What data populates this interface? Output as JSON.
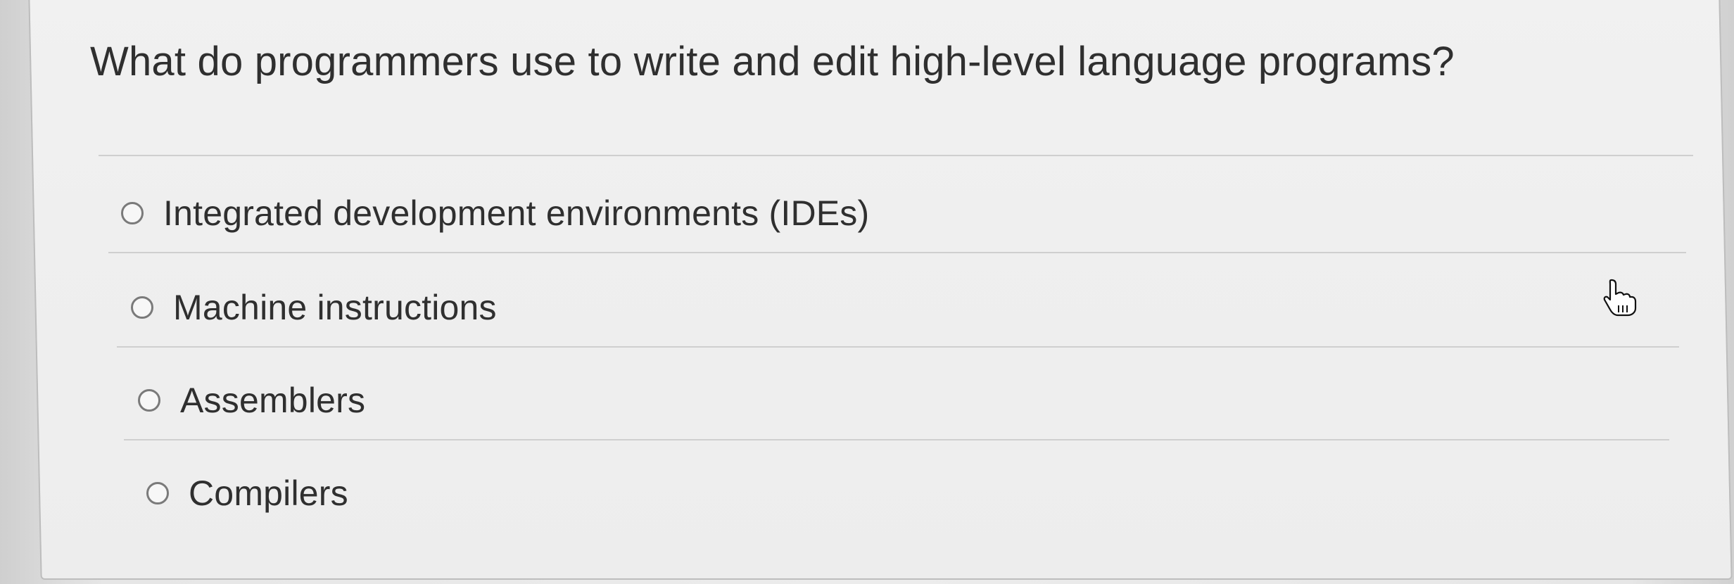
{
  "question": {
    "text": "What do programmers use to write and edit high-level language programs?"
  },
  "options": [
    {
      "label": "Integrated development environments (IDEs)",
      "selected": false
    },
    {
      "label": "Machine instructions",
      "selected": false
    },
    {
      "label": "Assemblers",
      "selected": false
    },
    {
      "label": "Compilers",
      "selected": false
    }
  ],
  "cursor": {
    "icon": "pointing-hand-cursor-icon"
  }
}
